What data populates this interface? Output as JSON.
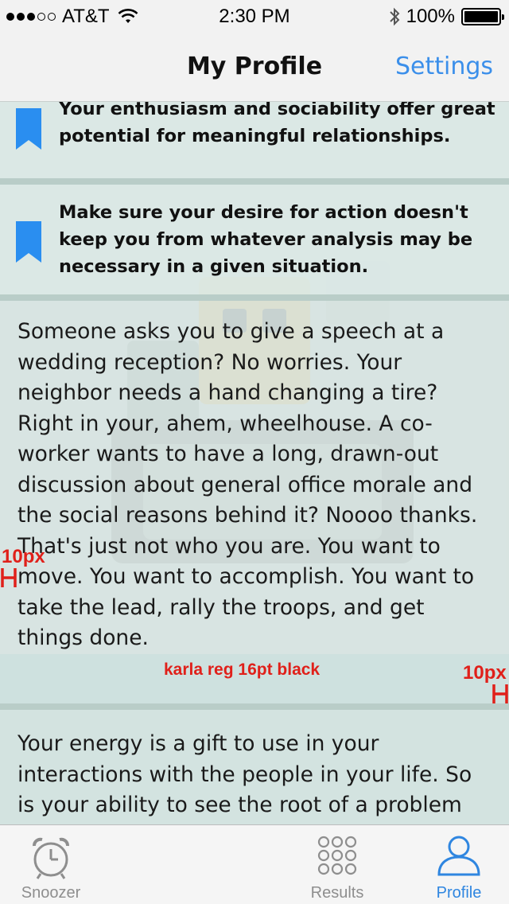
{
  "status_bar": {
    "carrier": "AT&T",
    "time": "2:30 PM",
    "battery": "100%",
    "signal_dots_filled": 3,
    "signal_dots_total": 5
  },
  "nav": {
    "title": "My Profile",
    "settings_label": "Settings"
  },
  "tips": [
    {
      "text": "Your enthusiasm and sociability offer great potential for meaningful relationships."
    },
    {
      "text": "Make sure your desire for action doesn't keep you from whatever analysis may be necessary in a given situation."
    }
  ],
  "paragraphs": [
    {
      "text": "Someone asks you to give a speech at a wedding reception?  No worries.  Your neighbor needs a hand changing a tire?  Right in your, ahem, wheelhouse.  A co-worker wants to have a long, drawn-out discussion about general office morale and the social reasons behind it?  Noooo thanks.  That's just not who you are.  You want to move.  You want to accomplish.  You want to take the lead, rally the troops, and get things done."
    },
    {
      "text": "Your energy is a gift to use in your interactions with the people in your life.  So is your ability to see the root of a problem and methodically address it."
    }
  ],
  "annotations": {
    "left_spacing": "10px",
    "font_spec": "karla reg 16pt black",
    "right_spacing": "10px"
  },
  "tabs": [
    {
      "label": "Snoozer"
    },
    {
      "label": "Results"
    },
    {
      "label": "Profile"
    }
  ],
  "colors": {
    "accent": "#3b8fea",
    "bookmark": "#2a8ef0",
    "annotation": "#e0201a",
    "background": "#d6e2df"
  }
}
